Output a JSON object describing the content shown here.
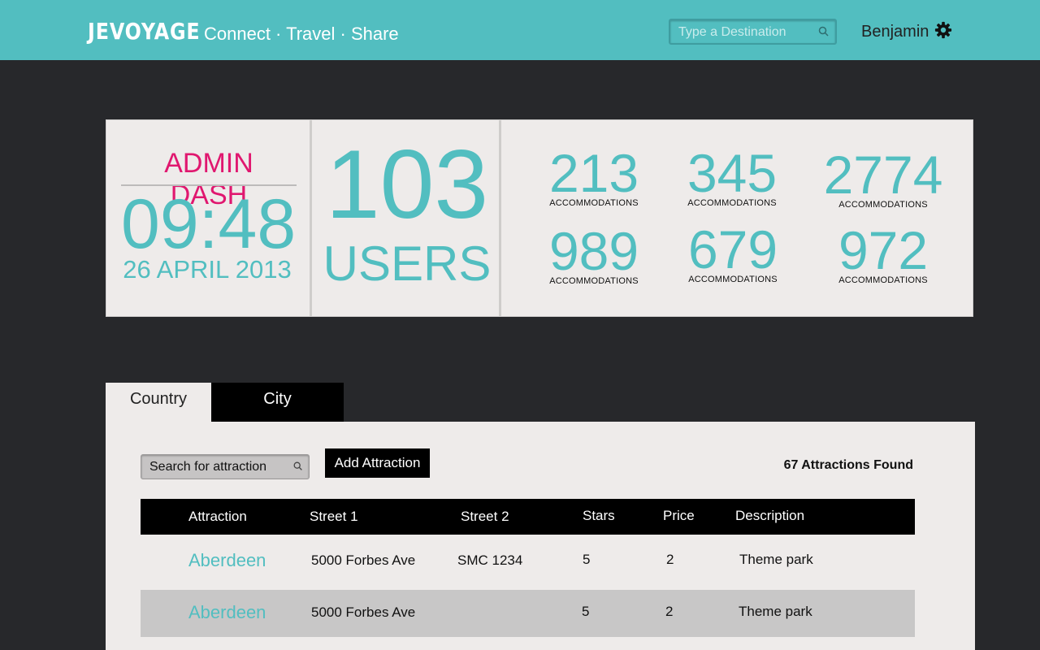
{
  "header": {
    "brand": "JEVOYAGE",
    "tagline": "Connect · Travel · Share",
    "search_placeholder": "Type a Destination",
    "user_name": "Benjamin"
  },
  "dashboard": {
    "title": "ADMIN DASH",
    "time": "09:48",
    "date": "26 APRIL 2013",
    "users_count": "103",
    "users_label": "USERS",
    "stats": [
      {
        "value": "213",
        "label": "ACCOMMODATIONS"
      },
      {
        "value": "345",
        "label": "ACCOMMODATIONS"
      },
      {
        "value": "2774",
        "label": "ACCOMMODATIONS"
      },
      {
        "value": "989",
        "label": "ACCOMMODATIONS"
      },
      {
        "value": "679",
        "label": "ACCOMMODATIONS"
      },
      {
        "value": "972",
        "label": "ACCOMMODATIONS"
      }
    ]
  },
  "tabs": [
    {
      "label": "Country",
      "active": true
    },
    {
      "label": "City",
      "active": false
    }
  ],
  "attractions": {
    "search_placeholder": "Search for attraction",
    "add_label": "Add Attraction",
    "found_text": "67 Attractions Found",
    "columns": [
      "Attraction",
      "Street 1",
      "Street 2",
      "Stars",
      "Price",
      "Description"
    ],
    "rows": [
      {
        "attraction": "Aberdeen",
        "street1": "5000 Forbes Ave",
        "street2": "SMC 1234",
        "stars": "5",
        "price": "2",
        "description": "Theme park"
      },
      {
        "attraction": "Aberdeen",
        "street1": "5000 Forbes Ave",
        "street2": "",
        "stars": "5",
        "price": "2",
        "description": "Theme park"
      }
    ]
  },
  "colors": {
    "accent": "#52bec0",
    "title_pink": "#e0176f",
    "background": "#27282b",
    "panel": "#eeebea"
  },
  "icons": {
    "search": "search-icon",
    "settings": "gear-icon"
  }
}
